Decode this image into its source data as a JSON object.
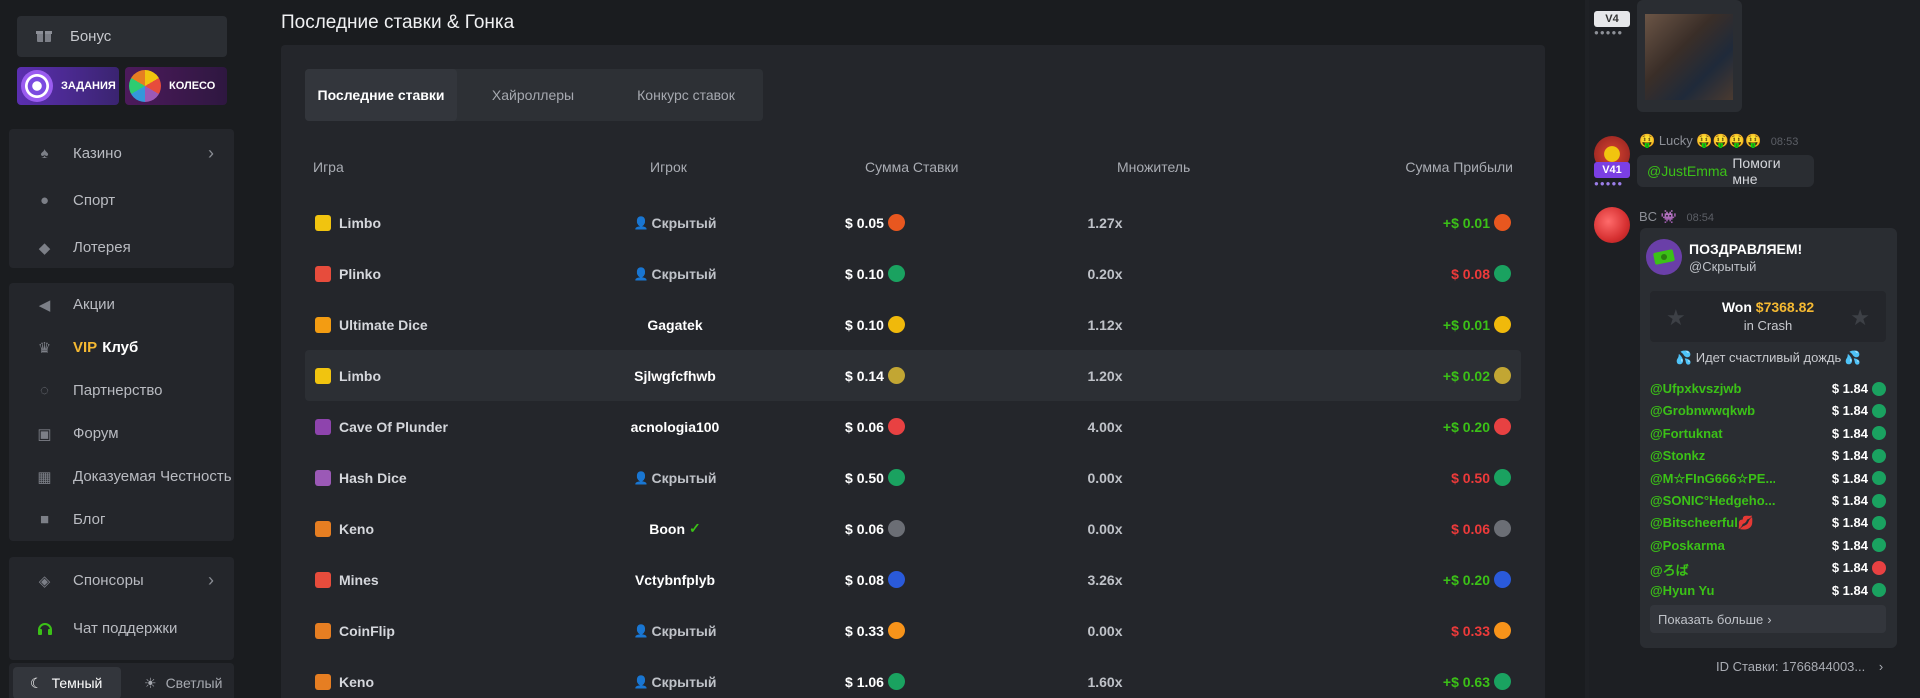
{
  "sidebar": {
    "bonus": "Бонус",
    "promos": [
      {
        "label": "ЗАДАНИЯ",
        "icon": "target-icon",
        "color": "#4b2a8a"
      },
      {
        "label": "КОЛЕСО",
        "icon": "wheel-icon",
        "color": "#5a1f6a"
      }
    ],
    "group1": [
      {
        "label": "Казино",
        "icon": "casino-icon",
        "has_arrow": true
      },
      {
        "label": "Спорт",
        "icon": "basketball-icon",
        "has_arrow": false
      },
      {
        "label": "Лотерея",
        "icon": "ticket-icon",
        "has_arrow": false
      }
    ],
    "group2": [
      {
        "label": "Акции",
        "icon": "megaphone-icon"
      },
      {
        "label_vip": "VIP",
        "label": "Клуб",
        "icon": "crown-icon"
      },
      {
        "label": "Партнерство",
        "icon": "partner-icon"
      },
      {
        "label": "Форум",
        "icon": "forum-icon"
      },
      {
        "label": "Доказуемая Честность",
        "icon": "fairness-icon"
      },
      {
        "label": "Блог",
        "icon": "blog-icon"
      }
    ],
    "sponsors": "Спонсоры",
    "support": "Чат поддержки",
    "theme": {
      "dark": "Темный",
      "light": "Светлый"
    }
  },
  "main": {
    "title": "Последние ставки & Гонка",
    "tabs": [
      "Последние ставки",
      "Хайроллеры",
      "Конкурс ставок"
    ],
    "columns": [
      "Игра",
      "Игрок",
      "Сумма Ставки",
      "Множитель",
      "Сумма Прибыли"
    ],
    "rows": [
      {
        "game": "Limbo",
        "game_color": "#f1c40f",
        "player": "Скрытый",
        "hidden": true,
        "bet": "$ 0.05",
        "coin": "#e8571f",
        "mult": "1.27x",
        "profit": "+$ 0.01",
        "pos": true
      },
      {
        "game": "Plinko",
        "game_color": "#e74c3c",
        "player": "Скрытый",
        "hidden": true,
        "bet": "$ 0.10",
        "coin": "#1aa260",
        "mult": "0.20x",
        "profit": "$ 0.08",
        "pos": false
      },
      {
        "game": "Ultimate Dice",
        "game_color": "#f39c12",
        "player": "Gagatek",
        "hidden": false,
        "bet": "$ 0.10",
        "coin": "#f0b90b",
        "mult": "1.12x",
        "profit": "+$ 0.01",
        "pos": true
      },
      {
        "game": "Limbo",
        "game_color": "#f1c40f",
        "player": "Sjlwgfcfhwb",
        "hidden": false,
        "bet": "$ 0.14",
        "coin": "#c2a633",
        "mult": "1.20x",
        "profit": "+$ 0.02",
        "pos": true
      },
      {
        "game": "Cave Of Plunder",
        "game_color": "#8e44ad",
        "player": "acnologia100",
        "hidden": false,
        "bet": "$ 0.06",
        "coin": "#e84142",
        "mult": "4.00x",
        "profit": "+$ 0.20",
        "pos": true
      },
      {
        "game": "Hash Dice",
        "game_color": "#9b59b6",
        "player": "Скрытый",
        "hidden": true,
        "bet": "$ 0.50",
        "coin": "#1aa260",
        "mult": "0.00x",
        "profit": "$ 0.50",
        "pos": false
      },
      {
        "game": "Keno",
        "game_color": "#e67e22",
        "player": "Boon",
        "hidden": false,
        "verified": true,
        "bet": "$ 0.06",
        "coin": "#6b6e75",
        "mult": "0.00x",
        "profit": "$ 0.06",
        "pos": false
      },
      {
        "game": "Mines",
        "game_color": "#e74c3c",
        "player": "Vctybnfplyb",
        "hidden": false,
        "bet": "$ 0.08",
        "coin": "#2a5ada",
        "mult": "3.26x",
        "profit": "+$ 0.20",
        "pos": true
      },
      {
        "game": "CoinFlip",
        "game_color": "#e67e22",
        "player": "Скрытый",
        "hidden": true,
        "bet": "$ 0.33",
        "coin": "#f7931a",
        "mult": "0.00x",
        "profit": "$ 0.33",
        "pos": false
      },
      {
        "game": "Keno",
        "game_color": "#e67e22",
        "player": "Скрытый",
        "hidden": true,
        "bet": "$ 1.06",
        "coin": "#1aa260",
        "mult": "1.60x",
        "profit": "+$ 0.63",
        "pos": true
      }
    ],
    "highlight_row": 3
  },
  "chat": {
    "top_level": "V4",
    "msg1": {
      "user": "Lucky",
      "emojis": "🤑🤑🤑🤑",
      "time": "08:53",
      "level": "V41",
      "mention": "@JustEmma",
      "text": "Помоги мне"
    },
    "msg2": {
      "user": "BC",
      "time": "08:54",
      "card": {
        "title": "ПОЗДРАВЛЯЕМ!",
        "subtitle": "@Скрытый",
        "won_label": "Won",
        "won_amount": "$7368.82",
        "won_game": "in Crash",
        "rain": "Идет счастливый дождь",
        "winners": [
          {
            "name": "@Ufpxkvszjwb",
            "amount": "$ 1.84",
            "coin": "#1aa260"
          },
          {
            "name": "@Grobnwwqkwb",
            "amount": "$ 1.84",
            "coin": "#1aa260"
          },
          {
            "name": "@Fortuknat",
            "amount": "$ 1.84",
            "coin": "#1aa260"
          },
          {
            "name": "@Stonkz",
            "amount": "$ 1.84",
            "coin": "#1aa260"
          },
          {
            "name": "@M☆FInG666☆PE...",
            "amount": "$ 1.84",
            "coin": "#1aa260"
          },
          {
            "name": "@SONIC°Hedgeho...",
            "amount": "$ 1.84",
            "coin": "#1aa260"
          },
          {
            "name": "@Bitscheerful💋",
            "amount": "$ 1.84",
            "coin": "#1aa260"
          },
          {
            "name": "@Poskarma",
            "amount": "$ 1.84",
            "coin": "#1aa260"
          },
          {
            "name": "@ろば",
            "amount": "$ 1.84",
            "coin": "#e84142"
          },
          {
            "name": "@Hyun Yu",
            "amount": "$ 1.84",
            "coin": "#1aa260"
          }
        ],
        "show_more": "Показать больше"
      }
    },
    "bet_id": "ID Ставки: 1766844003..."
  }
}
